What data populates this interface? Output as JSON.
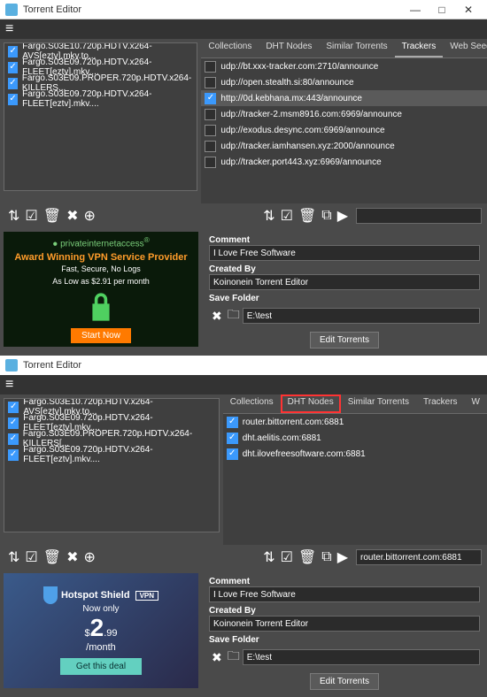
{
  "win1": {
    "title": "Torrent Editor",
    "files": [
      "Fargo.S03E10.720p.HDTV.x264-AVS[eztv].mkv.to...",
      "Fargo.S03E09.720p.HDTV.x264-FLEET[eztv].mkv....",
      "Fargo.S03E09.PROPER.720p.HDTV.x264-KILLERS...",
      "Fargo.S03E09.720p.HDTV.x264-FLEET[eztv].mkv...."
    ],
    "tabs": [
      "Collections",
      "DHT Nodes",
      "Similar Torrents",
      "Trackers",
      "Web Seeds"
    ],
    "active_tab": 3,
    "trackers": [
      {
        "checked": false,
        "url": "udp://bt.xxx-tracker.com:2710/announce"
      },
      {
        "checked": false,
        "url": "udp://open.stealth.si:80/announce"
      },
      {
        "checked": true,
        "url": "http://0d.kebhana.mx:443/announce",
        "sel": true
      },
      {
        "checked": false,
        "url": "udp://tracker-2.msm8916.com:6969/announce"
      },
      {
        "checked": false,
        "url": "udp://exodus.desync.com:6969/announce"
      },
      {
        "checked": false,
        "url": "udp://tracker.iamhansen.xyz:2000/announce"
      },
      {
        "checked": false,
        "url": "udp://tracker.port443.xyz:6969/announce"
      }
    ],
    "right_input": "",
    "comment_label": "Comment",
    "comment": "I Love Free Software",
    "createdby_label": "Created By",
    "createdby": "Koinonein Torrent Editor",
    "savefolder_label": "Save Folder",
    "savefolder": "E:\\test",
    "editbtn": "Edit Torrents",
    "ad": {
      "brand": "privateinternetaccess",
      "headline": "Award Winning VPN Service Provider",
      "line1": "Fast, Secure, No Logs",
      "line2": "As Low as $2.91 per month",
      "cta": "Start Now"
    }
  },
  "win2": {
    "title": "Torrent Editor",
    "files": [
      "Fargo.S03E10.720p.HDTV.x264-AVS[eztv].mkv.to...",
      "Fargo.S03E09.720p.HDTV.x264-FLEET[eztv].mkv....",
      "Fargo.S03E09.PROPER.720p.HDTV.x264-KILLERS[...",
      "Fargo.S03E09.720p.HDTV.x264-FLEET[eztv].mkv...."
    ],
    "tabs": [
      "Collections",
      "DHT Nodes",
      "Similar Torrents",
      "Trackers",
      "W"
    ],
    "hl_tab": 1,
    "dht": [
      {
        "checked": true,
        "url": "router.bittorrent.com:6881"
      },
      {
        "checked": true,
        "url": "dht.aelitis.com:6881"
      },
      {
        "checked": true,
        "url": "dht.ilovefreesoftware.com:6881"
      }
    ],
    "right_input": "router.bittorrent.com:6881",
    "comment_label": "Comment",
    "comment": "I Love Free Software",
    "createdby_label": "Created By",
    "createdby": "Koinonein Torrent Editor",
    "savefolder_label": "Save Folder",
    "savefolder": "E:\\test",
    "editbtn": "Edit Torrents",
    "ad": {
      "brand": "Hotspot Shield",
      "vpn": "VPN",
      "now": "Now only",
      "dollar": "$",
      "price": "2",
      "cents": ".99",
      "per": "/month",
      "cta": "Get this deal"
    }
  }
}
